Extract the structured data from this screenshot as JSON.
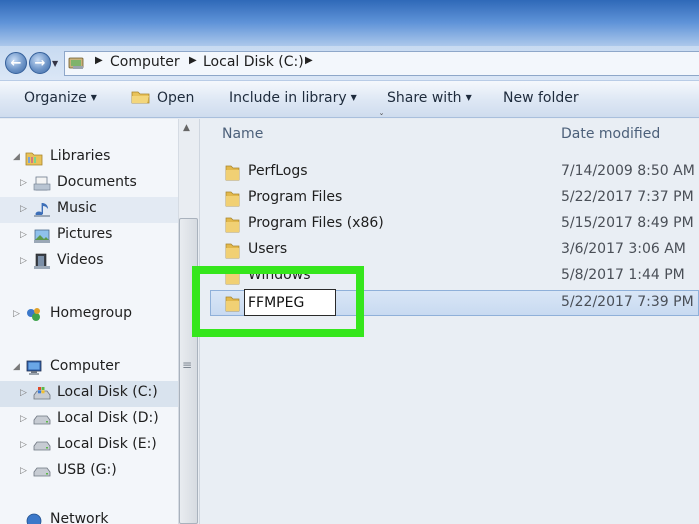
{
  "breadcrumb": {
    "items": [
      "Computer",
      "Local Disk (C:)"
    ]
  },
  "toolbar": {
    "organize": "Organize",
    "open": "Open",
    "include_in_library": "Include in library",
    "share_with": "Share with",
    "new_folder": "New folder"
  },
  "navigation": {
    "libraries": "Libraries",
    "documents": "Documents",
    "music": "Music",
    "pictures": "Pictures",
    "videos": "Videos",
    "homegroup": "Homegroup",
    "computer": "Computer",
    "drive_c": "Local Disk (C:)",
    "drive_d": "Local Disk (D:)",
    "drive_e": "Local Disk (E:)",
    "drive_g": "USB (G:)",
    "network": "Network"
  },
  "columns": {
    "name": "Name",
    "date_modified": "Date modified"
  },
  "files": [
    {
      "name": "PerfLogs",
      "date": "7/14/2009 8:50 AM"
    },
    {
      "name": "Program Files",
      "date": "5/22/2017 7:37 PM"
    },
    {
      "name": "Program Files (x86)",
      "date": "5/15/2017 8:49 PM"
    },
    {
      "name": "Users",
      "date": "3/6/2017 3:06 AM"
    },
    {
      "name": "Windows",
      "date": "5/8/2017 1:44 PM"
    },
    {
      "name": "FFMPEG",
      "date": "5/22/2017 7:39 PM"
    }
  ],
  "rename": {
    "value": "FFMPEG"
  },
  "colors": {
    "highlight": "#35e61c",
    "folder": "#e8c25a"
  },
  "icons": {
    "back": "back-arrow-icon",
    "forward": "forward-arrow-icon",
    "folder": "folder-icon",
    "drive": "hard-drive-icon",
    "library": "library-icon",
    "homegroup": "homegroup-icon",
    "computer": "computer-icon",
    "music": "music-icon",
    "pictures": "pictures-icon",
    "videos": "videos-icon",
    "documents": "documents-icon"
  }
}
